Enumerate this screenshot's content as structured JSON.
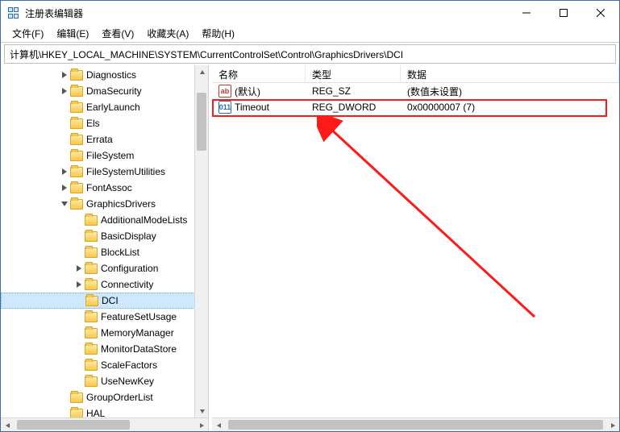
{
  "window": {
    "title": "注册表编辑器"
  },
  "menus": {
    "file": "文件(F)",
    "edit": "编辑(E)",
    "view": "查看(V)",
    "fav": "收藏夹(A)",
    "help": "帮助(H)"
  },
  "address": "计算机\\HKEY_LOCAL_MACHINE\\SYSTEM\\CurrentControlSet\\Control\\GraphicsDrivers\\DCI",
  "tree": {
    "items": [
      {
        "label": "Diagnostics",
        "depth": 4,
        "toggle": "closed"
      },
      {
        "label": "DmaSecurity",
        "depth": 4,
        "toggle": "closed"
      },
      {
        "label": "EarlyLaunch",
        "depth": 4,
        "toggle": "none"
      },
      {
        "label": "Els",
        "depth": 4,
        "toggle": "none"
      },
      {
        "label": "Errata",
        "depth": 4,
        "toggle": "none"
      },
      {
        "label": "FileSystem",
        "depth": 4,
        "toggle": "none"
      },
      {
        "label": "FileSystemUtilities",
        "depth": 4,
        "toggle": "closed"
      },
      {
        "label": "FontAssoc",
        "depth": 4,
        "toggle": "closed"
      },
      {
        "label": "GraphicsDrivers",
        "depth": 4,
        "toggle": "open"
      },
      {
        "label": "AdditionalModeLists",
        "depth": 5,
        "toggle": "none"
      },
      {
        "label": "BasicDisplay",
        "depth": 5,
        "toggle": "none"
      },
      {
        "label": "BlockList",
        "depth": 5,
        "toggle": "none"
      },
      {
        "label": "Configuration",
        "depth": 5,
        "toggle": "closed"
      },
      {
        "label": "Connectivity",
        "depth": 5,
        "toggle": "closed"
      },
      {
        "label": "DCI",
        "depth": 5,
        "toggle": "none",
        "selected": true
      },
      {
        "label": "FeatureSetUsage",
        "depth": 5,
        "toggle": "none"
      },
      {
        "label": "MemoryManager",
        "depth": 5,
        "toggle": "none"
      },
      {
        "label": "MonitorDataStore",
        "depth": 5,
        "toggle": "none"
      },
      {
        "label": "ScaleFactors",
        "depth": 5,
        "toggle": "none"
      },
      {
        "label": "UseNewKey",
        "depth": 5,
        "toggle": "none"
      },
      {
        "label": "GroupOrderList",
        "depth": 4,
        "toggle": "none"
      },
      {
        "label": "HAL",
        "depth": 4,
        "toggle": "none"
      }
    ]
  },
  "list": {
    "headers": {
      "name": "名称",
      "type": "类型",
      "data": "数据"
    },
    "rows": [
      {
        "icon": "str",
        "iconText": "ab",
        "name": "(默认)",
        "type": "REG_SZ",
        "data": "(数值未设置)"
      },
      {
        "icon": "bin",
        "iconText": "011",
        "name": "Timeout",
        "type": "REG_DWORD",
        "data": "0x00000007 (7)"
      }
    ]
  }
}
